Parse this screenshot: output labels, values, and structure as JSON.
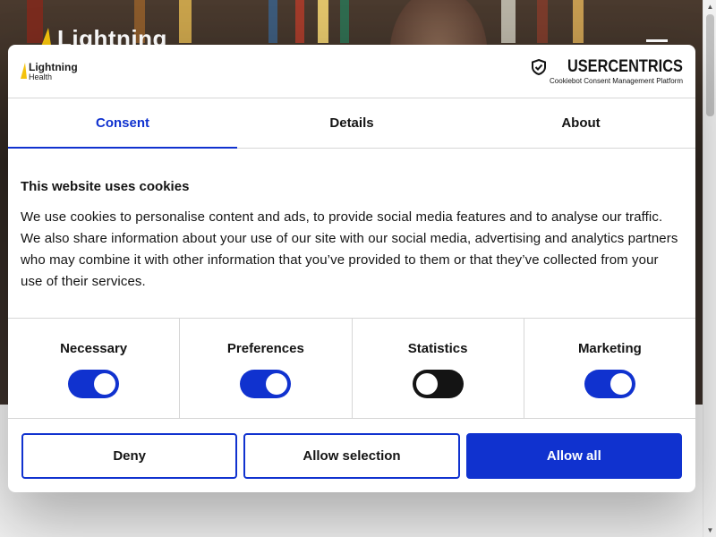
{
  "background": {
    "logo_text": "Lightning"
  },
  "dialog": {
    "brand": {
      "line1": "Lightning",
      "line2": "Health"
    },
    "provider": {
      "name": "USERCENTRICS",
      "tagline": "Cookiebot Consent Management Platform"
    },
    "tabs": [
      {
        "label": "Consent",
        "active": true
      },
      {
        "label": "Details",
        "active": false
      },
      {
        "label": "About",
        "active": false
      }
    ],
    "title": "This website uses cookies",
    "body": "We use cookies to personalise content and ads, to provide social media features and to analyse our traffic. We also share information about your use of our site with our social media, advertising and analytics partners who may combine it with other information that you’ve provided to them or that they’ve collected from your use of their services.",
    "toggles": [
      {
        "label": "Necessary",
        "state": "on",
        "disabled": true
      },
      {
        "label": "Preferences",
        "state": "on",
        "disabled": false
      },
      {
        "label": "Statistics",
        "state": "off",
        "disabled": false
      },
      {
        "label": "Marketing",
        "state": "on",
        "disabled": false
      }
    ],
    "buttons": {
      "deny": "Deny",
      "allow_selection": "Allow selection",
      "allow_all": "Allow all"
    }
  },
  "colors": {
    "accent": "#1032cf",
    "logo_yellow": "#f4c20d",
    "text": "#141414",
    "divider": "#d6d6d6"
  },
  "icons": {
    "brand": "lightning-bolt-icon",
    "provider": "shield-check-icon",
    "menu": "hamburger-menu-icon"
  }
}
